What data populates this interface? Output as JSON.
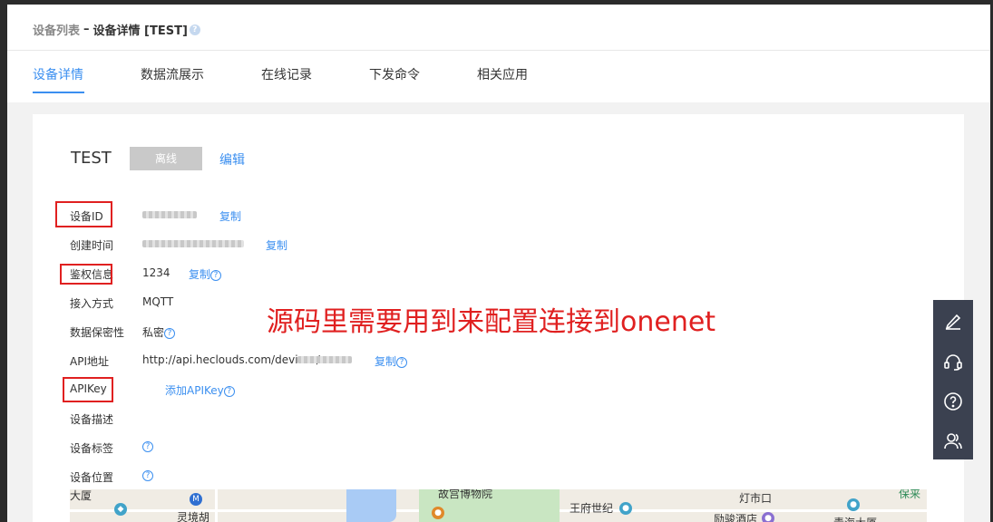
{
  "breadcrumb": {
    "list": "设备列表",
    "separator": "–",
    "current": "设备详情 [TEST]",
    "help_icon": "question-icon"
  },
  "tabs": [
    {
      "label": "设备详情",
      "active": true
    },
    {
      "label": "数据流展示",
      "active": false
    },
    {
      "label": "在线记录",
      "active": false
    },
    {
      "label": "下发命令",
      "active": false
    },
    {
      "label": "相关应用",
      "active": false
    }
  ],
  "device": {
    "name": "TEST",
    "status": "离线",
    "edit": "编辑"
  },
  "fields": {
    "device_id": {
      "label": "设备ID",
      "copy": "复制"
    },
    "created": {
      "label": "创建时间",
      "copy": "复制"
    },
    "auth": {
      "label": "鉴权信息",
      "value": "1234",
      "copy": "复制"
    },
    "access": {
      "label": "接入方式",
      "value": "MQTT"
    },
    "privacy": {
      "label": "数据保密性",
      "value": "私密"
    },
    "api_url": {
      "label": "API地址",
      "value": "http://api.heclouds.com/devices/",
      "copy": "复制"
    },
    "api_key": {
      "label": "APIKey",
      "add": "添加APIKey"
    },
    "desc": {
      "label": "设备描述"
    },
    "tags": {
      "label": "设备标签"
    },
    "location": {
      "label": "设备位置"
    }
  },
  "annotation": "源码里需要用到来配置连接到onenet",
  "map": {
    "labels": [
      "大厦",
      "灵境胡",
      "故宫博物院",
      "王府世纪",
      "灯市口",
      "励骏酒店",
      "青海大厦",
      "保来"
    ]
  },
  "float_bar": {
    "icons": [
      "edit-icon",
      "headset-icon",
      "help-icon",
      "users-icon"
    ]
  },
  "colors": {
    "accent": "#3b8ff0",
    "annotation": "#e02020",
    "badge": "#c9c9c9",
    "float_bar": "#3b4150"
  }
}
